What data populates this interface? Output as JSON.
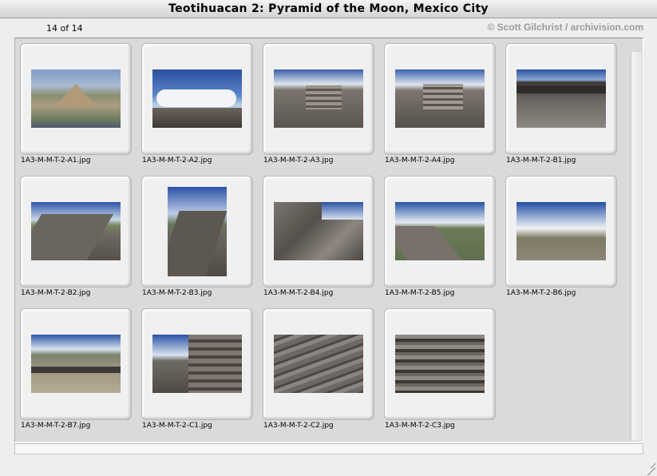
{
  "window": {
    "title": "Teotihuacan 2: Pyramid of the Moon, Mexico City",
    "counter": "14 of 14",
    "copyright": "© Scott Gilchrist / archivision.com"
  },
  "thumbnails": [
    {
      "filename": "1A3-M-M-T-2-A1.jpg"
    },
    {
      "filename": "1A3-M-M-T-2-A2.jpg"
    },
    {
      "filename": "1A3-M-M-T-2-A3.jpg"
    },
    {
      "filename": "1A3-M-M-T-2-A4.jpg"
    },
    {
      "filename": "1A3-M-M-T-2-B1.jpg"
    },
    {
      "filename": "1A3-M-M-T-2-B2.jpg"
    },
    {
      "filename": "1A3-M-M-T-2-B3.jpg"
    },
    {
      "filename": "1A3-M-M-T-2-B4.jpg"
    },
    {
      "filename": "1A3-M-M-T-2-B5.jpg"
    },
    {
      "filename": "1A3-M-M-T-2-B6.jpg"
    },
    {
      "filename": "1A3-M-M-T-2-B7.jpg"
    },
    {
      "filename": "1A3-M-M-T-2-C1.jpg"
    },
    {
      "filename": "1A3-M-M-T-2-C2.jpg"
    },
    {
      "filename": "1A3-M-M-T-2-C3.jpg"
    }
  ],
  "colors": {
    "frame_background": "#dadada",
    "copyright_text": "#9b9b9b"
  }
}
